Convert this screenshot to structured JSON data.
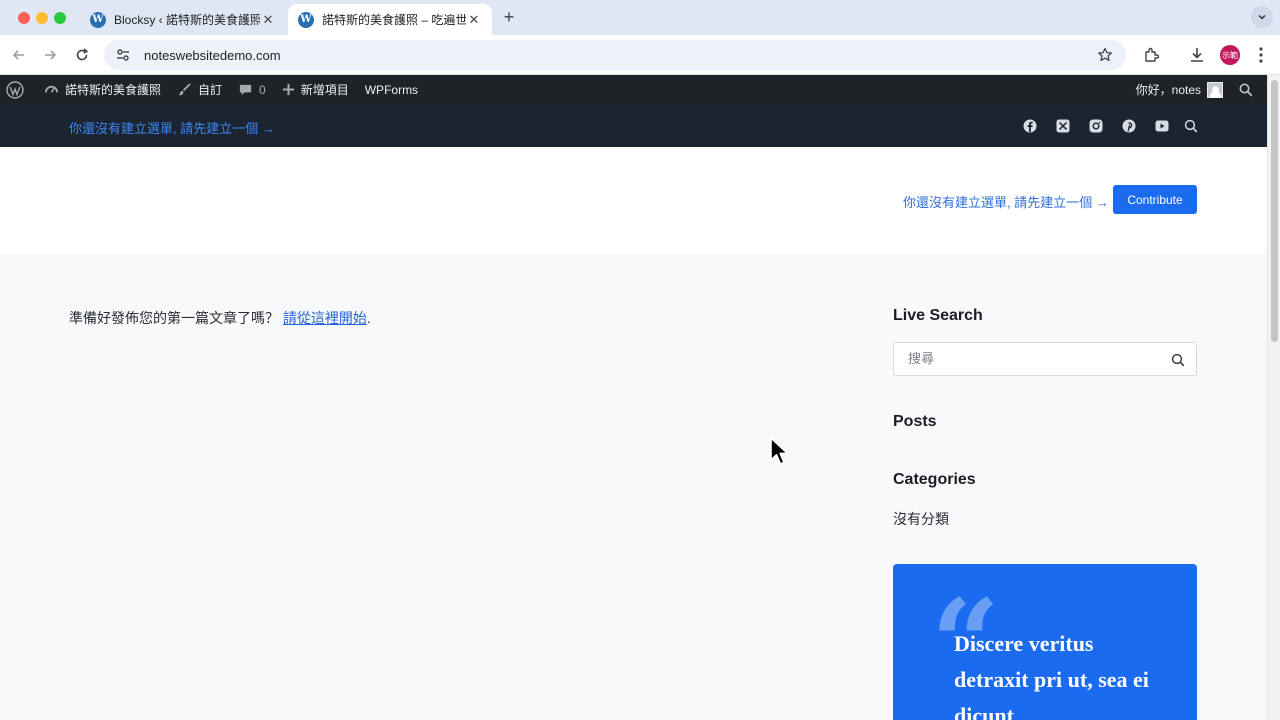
{
  "browser": {
    "tabs": [
      {
        "title": "Blocksy ‹ 諾特斯的美食護照 —",
        "favicon": "wordpress-icon",
        "active": false
      },
      {
        "title": "諾特斯的美食護照 – 吃遍世界",
        "favicon": "wordpress-icon",
        "active": true
      }
    ],
    "url": "noteswebsitedemo.com",
    "profile_label": "示範"
  },
  "admin_bar": {
    "site_name": "諾特斯的美食護照",
    "customize": "自訂",
    "comments_count": "0",
    "new_item": "新增項目",
    "wpforms": "WPForms",
    "greeting": "你好，notes"
  },
  "top_bar": {
    "menu_notice": "你還沒有建立選單, 請先建立一個 →",
    "social_icons": [
      "facebook-icon",
      "x-icon",
      "instagram-icon",
      "pinterest-icon",
      "youtube-icon",
      "search-icon"
    ]
  },
  "header": {
    "menu_notice": "你還沒有建立選單, 請先建立一個 →",
    "contribute_label": "Contribute"
  },
  "content": {
    "message": "準備好發佈您的第一篇文章了嗎？",
    "link_text": "請從這裡開始",
    "suffix": "."
  },
  "sidebar": {
    "live_search_title": "Live Search",
    "search_placeholder": "搜尋",
    "posts_title": "Posts",
    "categories_title": "Categories",
    "category_items": [
      "沒有分類"
    ],
    "quote_text": "Discere veritus detraxit pri ut, sea ei dicunt"
  },
  "colors": {
    "accent": "#1a6bf0",
    "admin_bar": "#1d2327",
    "top_bar": "#1b2532",
    "link": "#2563d6"
  }
}
